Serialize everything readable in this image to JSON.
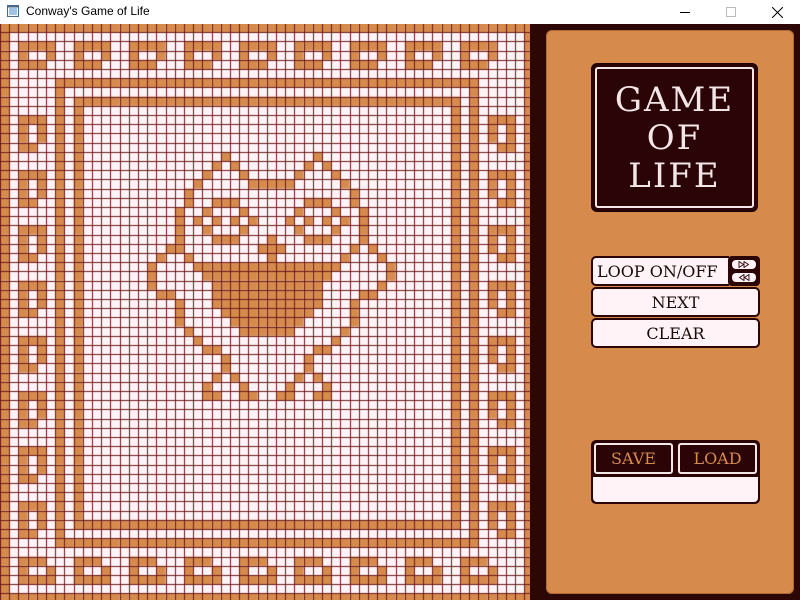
{
  "window": {
    "title": "Conway's Game of Life",
    "icons": [
      "app-icon",
      "minimize-icon",
      "maximize-icon",
      "close-icon"
    ]
  },
  "board": {
    "grid_color": "#6b1a1a",
    "alive_color": "#d68b4c",
    "dead_color": "#fff3f7",
    "rows": 63,
    "cols": 58
  },
  "panel": {
    "title_lines": [
      "GAME",
      "OF",
      "LIFE"
    ],
    "buttons": {
      "loop": "LOOP ON/OFF",
      "next": "NEXT",
      "clear": "CLEAR",
      "save": "SAVE",
      "load": "LOAD"
    },
    "speed_icons": [
      "fast-forward-icon",
      "rewind-icon"
    ],
    "filename_value": "",
    "colors": {
      "panel": "#d68b4c",
      "dark": "#2b0407",
      "light": "#fff3f7"
    }
  }
}
